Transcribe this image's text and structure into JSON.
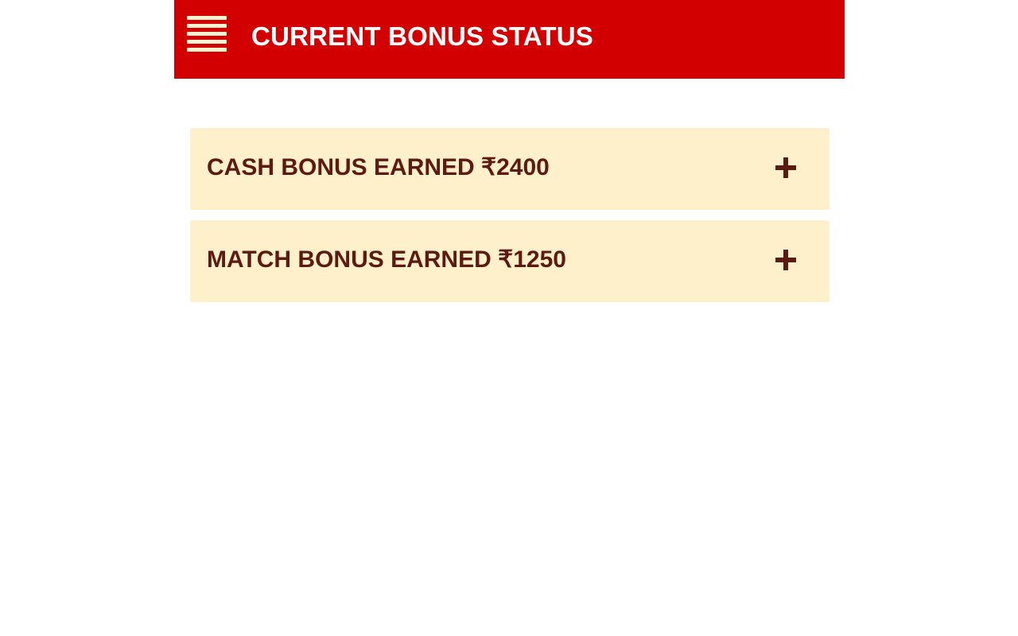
{
  "header": {
    "menu_icon": "hamburger-menu-icon",
    "title": "CURRENT BONUS STATUS"
  },
  "bonuses": [
    {
      "label": "CASH BONUS EARNED ₹2400",
      "icon": "plus-icon"
    },
    {
      "label": "MATCH BONUS EARNED ₹1250",
      "icon": "plus-icon"
    }
  ],
  "colors": {
    "header_background": "#d20000",
    "card_background": "#fff0cc",
    "card_text": "#5c1a10",
    "menu_icon": "#fff3cf"
  }
}
